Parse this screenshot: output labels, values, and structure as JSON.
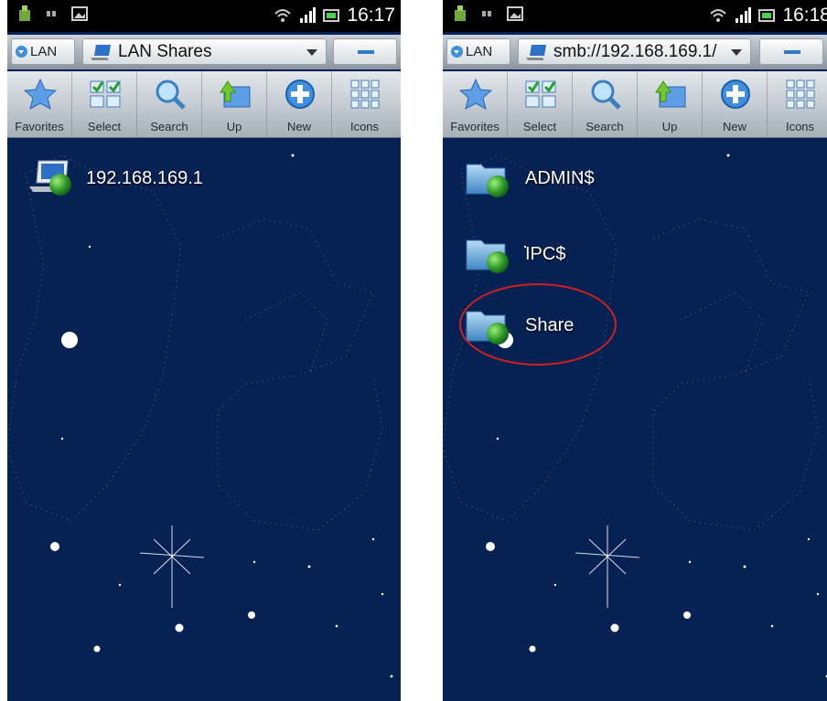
{
  "left_screen": {
    "status_time": "16:17",
    "lan_label": "LAN",
    "path": "LAN Shares",
    "toolbar": [
      "Favorites",
      "Select",
      "Search",
      "Up",
      "New",
      "Icons"
    ],
    "items": [
      {
        "name": "192.168.169.1",
        "icon": "network-computer-icon"
      }
    ]
  },
  "right_screen": {
    "status_time": "16:18",
    "lan_label": "LAN",
    "path": "smb://192.168.169.1/",
    "toolbar": [
      "Favorites",
      "Select",
      "Search",
      "Up",
      "New",
      "Icons"
    ],
    "items": [
      {
        "name": "ADMIN$",
        "icon": "network-folder-icon"
      },
      {
        "name": "IPC$",
        "icon": "network-folder-icon"
      },
      {
        "name": "Share",
        "icon": "network-folder-icon",
        "highlighted": true
      }
    ]
  },
  "colors": {
    "background": "#062153",
    "highlight_ring": "#d12020",
    "accent": "#2a7fd0"
  }
}
